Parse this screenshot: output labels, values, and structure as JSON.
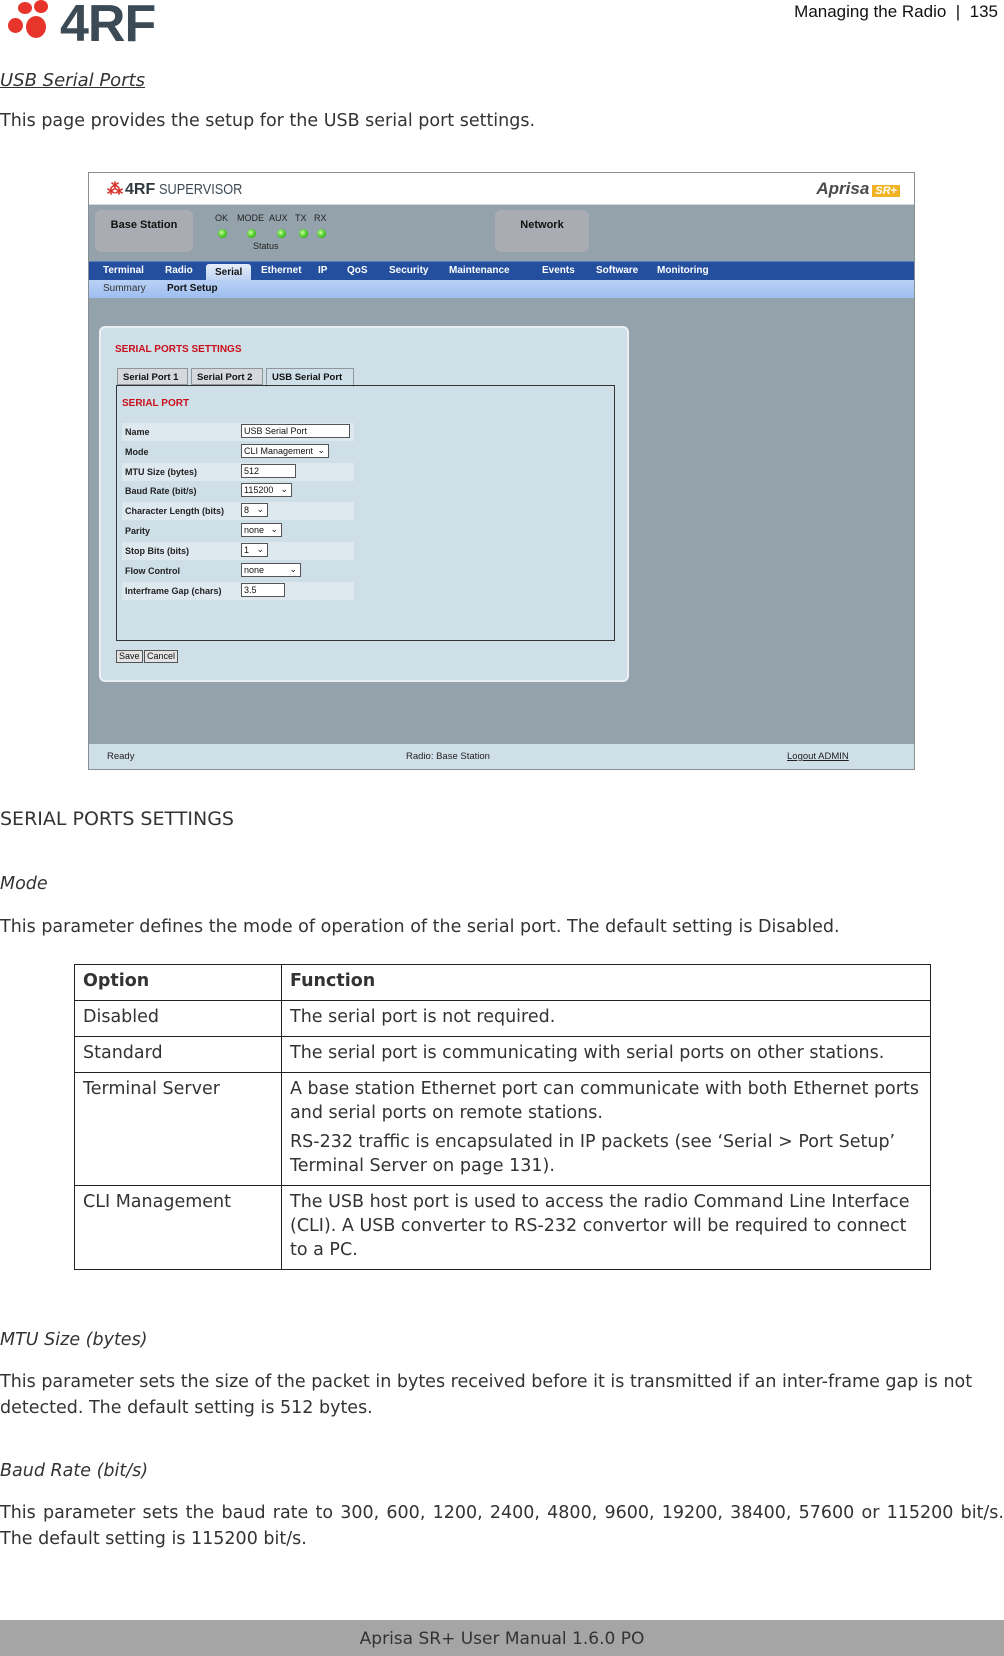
{
  "page_header": {
    "logo_text": "4RF",
    "running_head": "Managing the Radio  |  135"
  },
  "doc": {
    "title": "USB Serial Ports",
    "intro": "This page provides the setup for the USB serial port settings."
  },
  "app": {
    "brand": "4RF",
    "brand_product": "SUPERVISOR",
    "product_logo": "Aprisa",
    "product_badge": "SR+",
    "station_box": "Base Station",
    "network_box": "Network",
    "leds": [
      {
        "label": "OK",
        "color": "#3cc21a"
      },
      {
        "label": "MODE",
        "color": "#3cc21a"
      },
      {
        "label": "AUX",
        "color": "#3cc21a"
      },
      {
        "label": "TX",
        "color": "#3cc21a"
      },
      {
        "label": "RX",
        "color": "#3cc21a"
      }
    ],
    "status_caption": "Status",
    "nav": [
      "Terminal",
      "Radio",
      "Serial",
      "Ethernet",
      "IP",
      "QoS",
      "Security",
      "Maintenance",
      "Events",
      "Software",
      "Monitoring"
    ],
    "nav_active": "Serial",
    "subnav": [
      "Summary",
      "Port Setup"
    ],
    "subnav_active": "Port Setup",
    "panel_title": "SERIAL PORTS SETTINGS",
    "tabs": [
      "Serial Port 1",
      "Serial Port 2",
      "USB Serial Port"
    ],
    "tab_active": "USB Serial Port",
    "section_title": "SERIAL PORT",
    "fields": [
      {
        "label": "Name",
        "type": "text",
        "value": "USB Serial Port"
      },
      {
        "label": "Mode",
        "type": "select",
        "value": "CLI Management"
      },
      {
        "label": "MTU Size (bytes)",
        "type": "text",
        "value": "512"
      },
      {
        "label": "Baud Rate (bit/s)",
        "type": "select",
        "value": "115200"
      },
      {
        "label": "Character Length (bits)",
        "type": "select",
        "value": "8"
      },
      {
        "label": "Parity",
        "type": "select",
        "value": "none"
      },
      {
        "label": "Stop Bits (bits)",
        "type": "select",
        "value": "1"
      },
      {
        "label": "Flow Control",
        "type": "select",
        "value": "none"
      },
      {
        "label": "Interframe Gap (chars)",
        "type": "text",
        "value": "3.5"
      }
    ],
    "save_label": "Save",
    "cancel_label": "Cancel",
    "footer_status": "Ready",
    "footer_radio": "Radio: Base Station",
    "footer_logout": "Logout ADMIN",
    "colors": {
      "nav": "#234f9e",
      "panel": "#cfdfe8",
      "accent_red": "#c8101b"
    }
  },
  "settings_heading": "SERIAL PORTS SETTINGS",
  "mode": {
    "heading": "Mode",
    "desc": "This parameter defines the mode of operation of the serial port. The default setting is Disabled.",
    "table": {
      "headers": [
        "Option",
        "Function"
      ],
      "rows": [
        {
          "option": "Disabled",
          "function": [
            "The serial port is not required."
          ]
        },
        {
          "option": "Standard",
          "function": [
            "The serial port is communicating with serial ports on other stations."
          ]
        },
        {
          "option": "Terminal Server",
          "function": [
            "A base station Ethernet port can communicate with both Ethernet ports and serial ports on remote stations.",
            "RS-232 traffic is encapsulated in IP packets (see ‘Serial > Port Setup’ Terminal Server on page 131)."
          ]
        },
        {
          "option": "CLI Management",
          "function": [
            "The USB host port is used to access the radio Command Line Interface (CLI). A USB converter to RS-232 convertor will be required to connect to a PC."
          ]
        }
      ]
    }
  },
  "mtu": {
    "heading": "MTU Size (bytes)",
    "desc": "This parameter sets the size of the packet in bytes received before it is transmitted if an inter-frame gap is not detected. The default setting is 512 bytes."
  },
  "baud": {
    "heading": "Baud Rate (bit/s)",
    "desc": "This parameter sets the baud rate to 300, 600, 1200, 2400, 4800, 9600, 19200, 38400, 57600 or 115200 bit/s. The default setting is 115200 bit/s."
  },
  "footer": "Aprisa SR+ User Manual 1.6.0 PO"
}
